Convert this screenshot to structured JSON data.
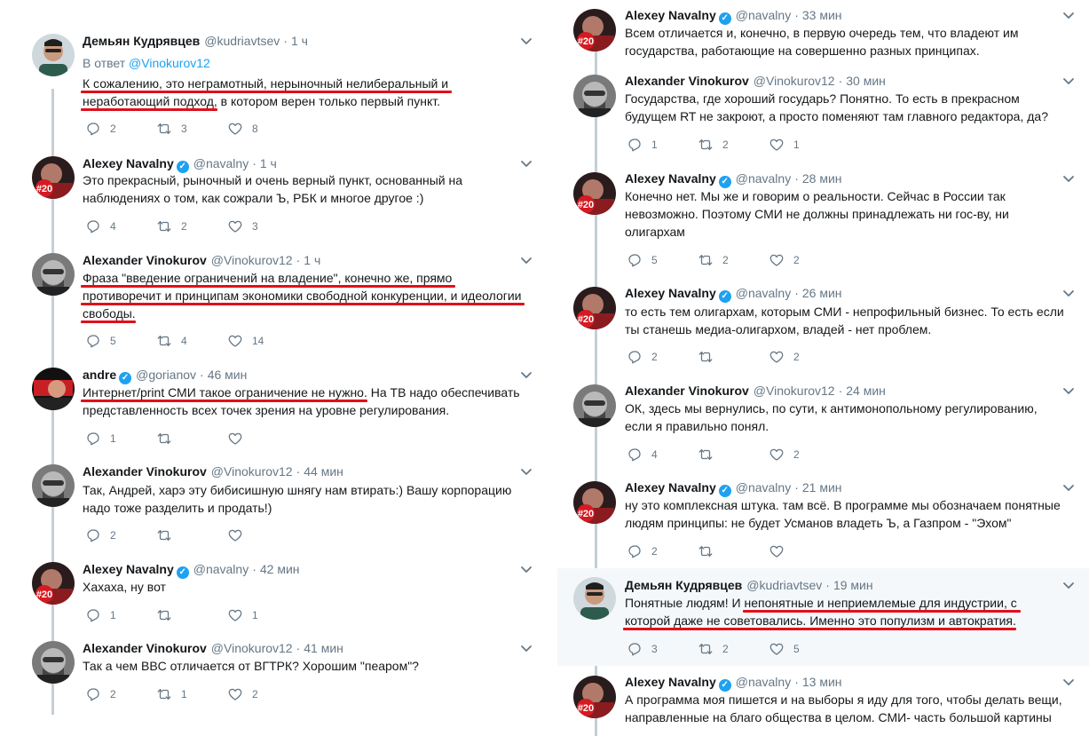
{
  "colors": {
    "link": "#1da1f2",
    "underline": "#e0101a",
    "meta": "#657786",
    "thread_line": "#c4cfd6",
    "highlight_bg": "#f5f8fa"
  },
  "icons": {
    "reply": "reply-icon",
    "retweet": "retweet-icon",
    "like": "like-icon",
    "caret": "chevron-down-icon",
    "verified": "verified-badge-icon"
  },
  "left": {
    "tweets": [
      {
        "name": "Демьян Кудрявцев",
        "handle": "@kudriavtsev",
        "time": "1 ч",
        "reply_to_prefix": "В ответ",
        "reply_to_handle": "@Vinokurov12",
        "lines": [
          [
            [
              "К сожалению, это неграмотный, нерыночный нелиберальный и",
              true
            ]
          ],
          [
            [
              "неработающий подход",
              true
            ],
            [
              ", в котором верен только первый пункт.",
              false
            ]
          ]
        ],
        "replies": "2",
        "retweets": "3",
        "likes": "8"
      },
      {
        "name": "Alexey Navalny",
        "handle": "@navalny",
        "time": "1 ч",
        "lines": [
          [
            [
              "Это прекрасный, рыночный и очень верный пункт, основанный на",
              false
            ]
          ],
          [
            [
              "наблюдениях о том, как сожрали Ъ, РБК и многое другое :)",
              false
            ]
          ]
        ],
        "replies": "4",
        "retweets": "2",
        "likes": "3"
      },
      {
        "name": "Alexander Vinokurov",
        "handle": "@Vinokurov12",
        "time": "1 ч",
        "lines": [
          [
            [
              "Фраза \"введение ограничений на владение\", конечно же, прямо",
              true
            ]
          ],
          [
            [
              "противоречит и принципам экономики свободной конкуренции",
              true
            ],
            [
              ", и идеологии",
              true
            ]
          ],
          [
            [
              "свободы",
              true
            ],
            [
              ".",
              false
            ]
          ]
        ],
        "replies": "5",
        "retweets": "4",
        "likes": "14"
      },
      {
        "name": "andre",
        "handle": "@gorianov",
        "time": "46 мин",
        "lines": [
          [
            [
              "Интернет/print СМИ такое ограничение не нужно",
              true
            ],
            [
              ". На ТВ надо обеспечивать",
              false
            ]
          ],
          [
            [
              "представленность всех точек зрения на уровне регулирования.",
              false
            ]
          ]
        ],
        "replies": "1",
        "retweets": "",
        "likes": ""
      },
      {
        "name": "Alexander Vinokurov",
        "handle": "@Vinokurov12",
        "time": "44 мин",
        "lines": [
          [
            [
              "Так, Андрей, харэ эту бибисишную шнягу нам втирать:) Вашу корпорацию",
              false
            ]
          ],
          [
            [
              "надо тоже разделить и продать!)",
              false
            ]
          ]
        ],
        "replies": "2",
        "retweets": "",
        "likes": ""
      },
      {
        "name": "Alexey Navalny",
        "handle": "@navalny",
        "time": "42 мин",
        "lines": [
          [
            [
              "Хахаха, ну вот",
              false
            ]
          ]
        ],
        "replies": "1",
        "retweets": "",
        "likes": "1"
      },
      {
        "name": "Alexander Vinokurov",
        "handle": "@Vinokurov12",
        "time": "41 мин",
        "lines": [
          [
            [
              "Так а чем BBC отличается от ВГТРК? Хорошим \"пеаром\"?",
              false
            ]
          ]
        ],
        "replies": "2",
        "retweets": "1",
        "likes": "2"
      }
    ]
  },
  "right": {
    "tweets": [
      {
        "name": "Alexey Navalny",
        "handle": "@navalny",
        "time": "33 мин",
        "lines": [
          [
            [
              "Всем отличается и, конечно, в первую очередь тем, что владеют им",
              false
            ]
          ],
          [
            [
              "государства, работающие на совершенно разных принципах.",
              false
            ]
          ]
        ],
        "replies": "",
        "retweets": "",
        "likes": ""
      },
      {
        "name": "Alexander Vinokurov",
        "handle": "@Vinokurov12",
        "time": "30 мин",
        "lines": [
          [
            [
              "Государства, где хороший государь? Понятно. То есть в прекрасном",
              false
            ]
          ],
          [
            [
              "будущем RT не закроют, а просто поменяют там главного редактора, да?",
              false
            ]
          ]
        ],
        "replies": "1",
        "retweets": "2",
        "likes": "1"
      },
      {
        "name": "Alexey Navalny",
        "handle": "@navalny",
        "time": "28 мин",
        "lines": [
          [
            [
              "Конечно нет. Мы же и говорим о реальности. Сейчас в России так",
              false
            ]
          ],
          [
            [
              "невозможно. Поэтому СМИ не должны принадлежать ни гос-ву, ни",
              false
            ]
          ],
          [
            [
              "олигархам",
              false
            ]
          ]
        ],
        "replies": "5",
        "retweets": "2",
        "likes": "2"
      },
      {
        "name": "Alexey Navalny",
        "handle": "@navalny",
        "time": "26 мин",
        "lines": [
          [
            [
              "то есть тем олигархам, которым СМИ - непрофильный бизнес. То есть если",
              false
            ]
          ],
          [
            [
              "ты станешь медиа-олигархом, владей - нет проблем.",
              false
            ]
          ]
        ],
        "replies": "2",
        "retweets": "",
        "likes": "2"
      },
      {
        "name": "Alexander Vinokurov",
        "handle": "@Vinokurov12",
        "time": "24 мин",
        "lines": [
          [
            [
              "ОК, здесь мы вернулись, по сути, к антимонопольному регулированию,",
              false
            ]
          ],
          [
            [
              "если я правильно понял.",
              false
            ]
          ]
        ],
        "replies": "4",
        "retweets": "",
        "likes": "2"
      },
      {
        "name": "Alexey Navalny",
        "handle": "@navalny",
        "time": "21 мин",
        "lines": [
          [
            [
              "ну это комплексная штука. там всё. В программе мы обозначаем понятные",
              false
            ]
          ],
          [
            [
              "людям принципы: не будет Усманов владеть Ъ, а Газпром - \"Эхом\"",
              false
            ]
          ]
        ],
        "replies": "2",
        "retweets": "",
        "likes": ""
      },
      {
        "name": "Демьян Кудрявцев",
        "handle": "@kudriavtsev",
        "time": "19 мин",
        "lines": [
          [
            [
              "Понятные людям! И ",
              false
            ],
            [
              "непонятные и неприемлемые для индустрии, с",
              true
            ]
          ],
          [
            [
              "которой даже не советовались. Именно это популизм и автократия",
              true
            ],
            [
              ".",
              false
            ]
          ]
        ],
        "replies": "3",
        "retweets": "2",
        "likes": "5"
      },
      {
        "name": "Alexey Navalny",
        "handle": "@navalny",
        "time": "13 мин",
        "lines": [
          [
            [
              "А программа моя пишется и на выборы я иду для того, чтобы делать вещи,",
              false
            ]
          ],
          [
            [
              "направленные на благо общества в целом. СМИ- часть большой картины",
              false
            ]
          ]
        ],
        "replies": "",
        "retweets": "",
        "likes": ""
      }
    ]
  }
}
